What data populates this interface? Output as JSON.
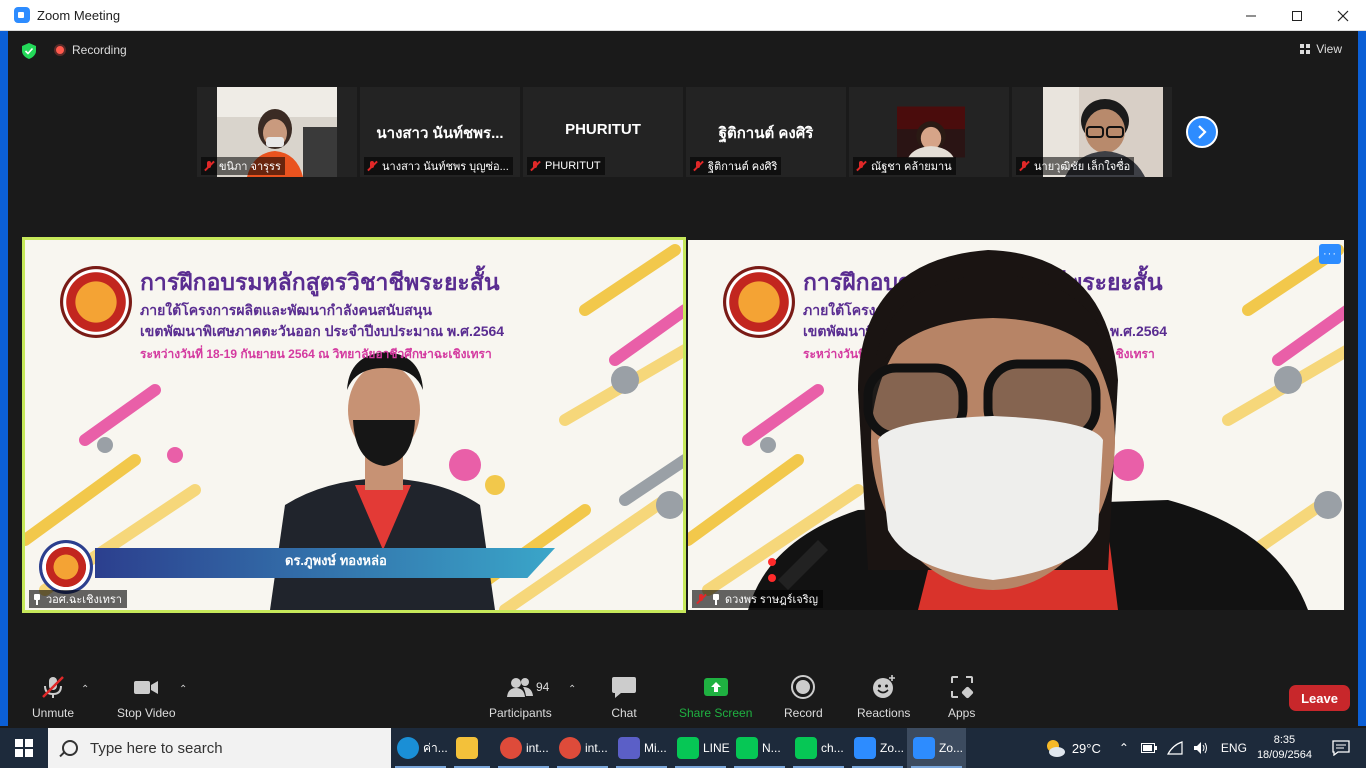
{
  "window": {
    "title": "Zoom Meeting"
  },
  "topbar": {
    "recording_label": "Recording",
    "view_label": "View"
  },
  "thumbnails": [
    {
      "label": "ขนิภา จารุรร",
      "big_name": ""
    },
    {
      "label": "นางสาว นันท์ชพร บุญซ่อ...",
      "big_name": "นางสาว นันท์ชพร..."
    },
    {
      "label": "PHURITUT",
      "big_name": "PHURITUT"
    },
    {
      "label": "ฐิติกานต์ คงศิริ",
      "big_name": "ฐิติกานต์ คงศิริ"
    },
    {
      "label": "ณัฐชา คล้ายมาน",
      "big_name": ""
    },
    {
      "label": "นายวุฒิชัย เล็กใจซื่อ",
      "big_name": ""
    }
  ],
  "main_left": {
    "banner_title": "การฝึกอบรมหลักสูตรวิชาชีพระยะสั้น",
    "banner_line1": "ภายใต้โครงการผลิตและพัฒนากำลังคนสนับสนุน",
    "banner_line2": "เขตพัฒนาพิเศษภาคตะวันออก ประจำปีงบประมาณ พ.ศ.2564",
    "banner_line3": "ระหว่างวันที่ 18-19 กันยายน 2564 ณ วิทยาลัยอาชีวศึกษาฉะเชิงเทรา",
    "name_caption": "ดร.ภูพงษ์ ทองหล่อ",
    "label": "วอศ.ฉะเชิงเทรา"
  },
  "main_right": {
    "banner_title": "การฝึกอบรมหลักสูตรวิชาชีพระยะสั้น",
    "banner_line1": "ภายใต้โครงการผลิตและพัฒนากำลังคนสนับสนุน",
    "banner_line2": "เขตพัฒนาพิเศษภาคตะวันออก ประจำปีงบประมาณ พ.ศ.2564",
    "banner_line3": "ระหว่างวันที่ 18-19 กันยายน 2564 ณ วิทยาลัยอาชีวศึกษาฉะเชิงเทรา",
    "label": "ดวงพร ราษฎร์เจริญ",
    "more_label": "···"
  },
  "toolbar": {
    "unmute": "Unmute",
    "stop_video": "Stop Video",
    "participants": "Participants",
    "participant_count": "94",
    "chat": "Chat",
    "share_screen": "Share Screen",
    "record": "Record",
    "reactions": "Reactions",
    "apps": "Apps",
    "leave": "Leave",
    "share_color": "#1fb141",
    "leave_color": "#c8272b"
  },
  "taskbar": {
    "search_placeholder": "Type here to search",
    "apps": [
      {
        "label": "ค่า...",
        "icon": "edge-icon",
        "color": "#1a8fd6"
      },
      {
        "label": "",
        "icon": "folder-icon",
        "color": "#f3c13a"
      },
      {
        "label": "int...",
        "icon": "chrome-icon",
        "color": "#de4b3a"
      },
      {
        "label": "int...",
        "icon": "chrome-icon",
        "color": "#de4b3a"
      },
      {
        "label": "Mi...",
        "icon": "teams-icon",
        "color": "#5b5fc7"
      },
      {
        "label": "LINE",
        "icon": "line-icon",
        "color": "#06c755"
      },
      {
        "label": "N...",
        "icon": "line-icon",
        "color": "#06c755"
      },
      {
        "label": "ch...",
        "icon": "line-icon",
        "color": "#06c755"
      },
      {
        "label": "Zo...",
        "icon": "zoom-icon",
        "color": "#2d8cff"
      },
      {
        "label": "Zo...",
        "icon": "zoom-icon",
        "color": "#2d8cff"
      }
    ],
    "temperature": "29°C",
    "language": "ENG",
    "time": "8:35",
    "date": "18/09/2564"
  }
}
